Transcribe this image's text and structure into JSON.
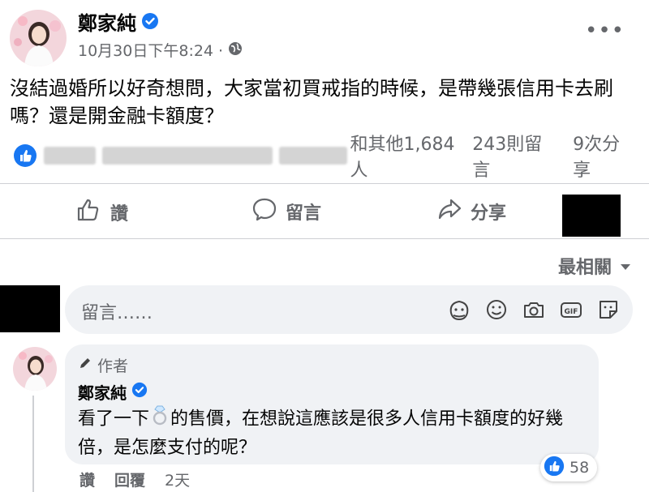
{
  "post": {
    "author": "鄭家純",
    "timestamp": "10月30日下午8:24",
    "separator": "·",
    "more": "•••",
    "text": "沒結過婚所以好奇想問，大家當初買戒指的時候，是帶幾張信用卡去刷嗎？還是開金融卡額度？"
  },
  "reactions": {
    "others_text": "和其他1,684人",
    "comments": "243則留言",
    "shares": "9次分享"
  },
  "actions": {
    "like": "讚",
    "comment": "留言",
    "share": "分享"
  },
  "sort": {
    "label": "最相關"
  },
  "comment_input": {
    "placeholder": "留言……",
    "icons": [
      "avatar-sticker-icon",
      "emoji-icon",
      "camera-icon",
      "gif-icon",
      "sticker-icon"
    ]
  },
  "comment": {
    "badge": "作者",
    "author": "鄭家純",
    "text_before": "看了一下",
    "text_after": "的售價，在想說這應該是很多人信用卡額度的好幾倍，是怎麼支付的呢？",
    "like_count": "58",
    "like_label": "讚",
    "reply_label": "回覆",
    "time": "2天"
  },
  "colors": {
    "facebook_blue": "#1877f2",
    "secondary_text": "#65676b",
    "bubble_bg": "#f0f2f5"
  }
}
